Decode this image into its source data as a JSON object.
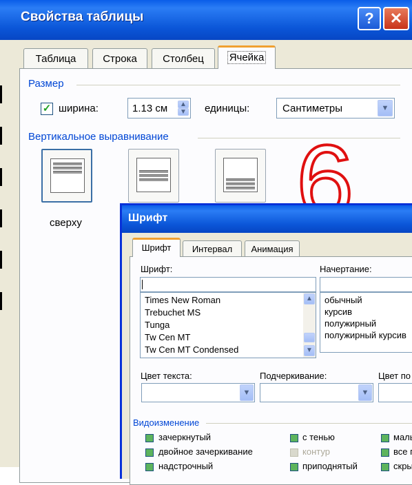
{
  "dialog1": {
    "title": "Свойства таблицы",
    "help_glyph": "?",
    "close_glyph": "✕",
    "tabs": [
      "Таблица",
      "Строка",
      "Столбец",
      "Ячейка"
    ],
    "active_tab": "Ячейка",
    "size_group": "Размер",
    "width_checkbox_label": "ширина:",
    "width_checked": true,
    "width_value": "1.13 см",
    "units_label": "единицы:",
    "units_value": "Сантиметры",
    "valign_group": "Вертикальное выравнивание",
    "valign_options": [
      "сверху",
      "по центру",
      "снизу"
    ],
    "valign_top_label": "сверху"
  },
  "overlay_number": "6",
  "dialog2": {
    "title": "Шрифт",
    "tabs": [
      "Шрифт",
      "Интервал",
      "Анимация"
    ],
    "font_label": "Шрифт:",
    "font_value": "",
    "style_label": "Начертание:",
    "font_list": [
      "Times New Roman",
      "Trebuchet MS",
      "Tunga",
      "Tw Cen MT",
      "Tw Cen MT Condensed"
    ],
    "style_list": [
      "обычный",
      "курсив",
      "полужирный",
      "полужирный курсив"
    ],
    "text_color_label": "Цвет текста:",
    "underline_label": "Подчеркивание:",
    "underline_color_label": "Цвет по",
    "effects_group": "Видоизменение",
    "effects_col1": [
      "зачеркнутый",
      "двойное зачеркивание",
      "надстрочный"
    ],
    "effects_col2": [
      "с тенью",
      "контур",
      "приподнятый"
    ],
    "effects_col3": [
      "малы",
      "все п",
      "скры"
    ]
  },
  "colors": {
    "titlebar_blue": "#0b56d8",
    "dialog_face": "#ece9d8",
    "group_label_blue": "#0046d5",
    "overlay_red": "#e01010",
    "active_tab_accent": "#f0a030"
  }
}
